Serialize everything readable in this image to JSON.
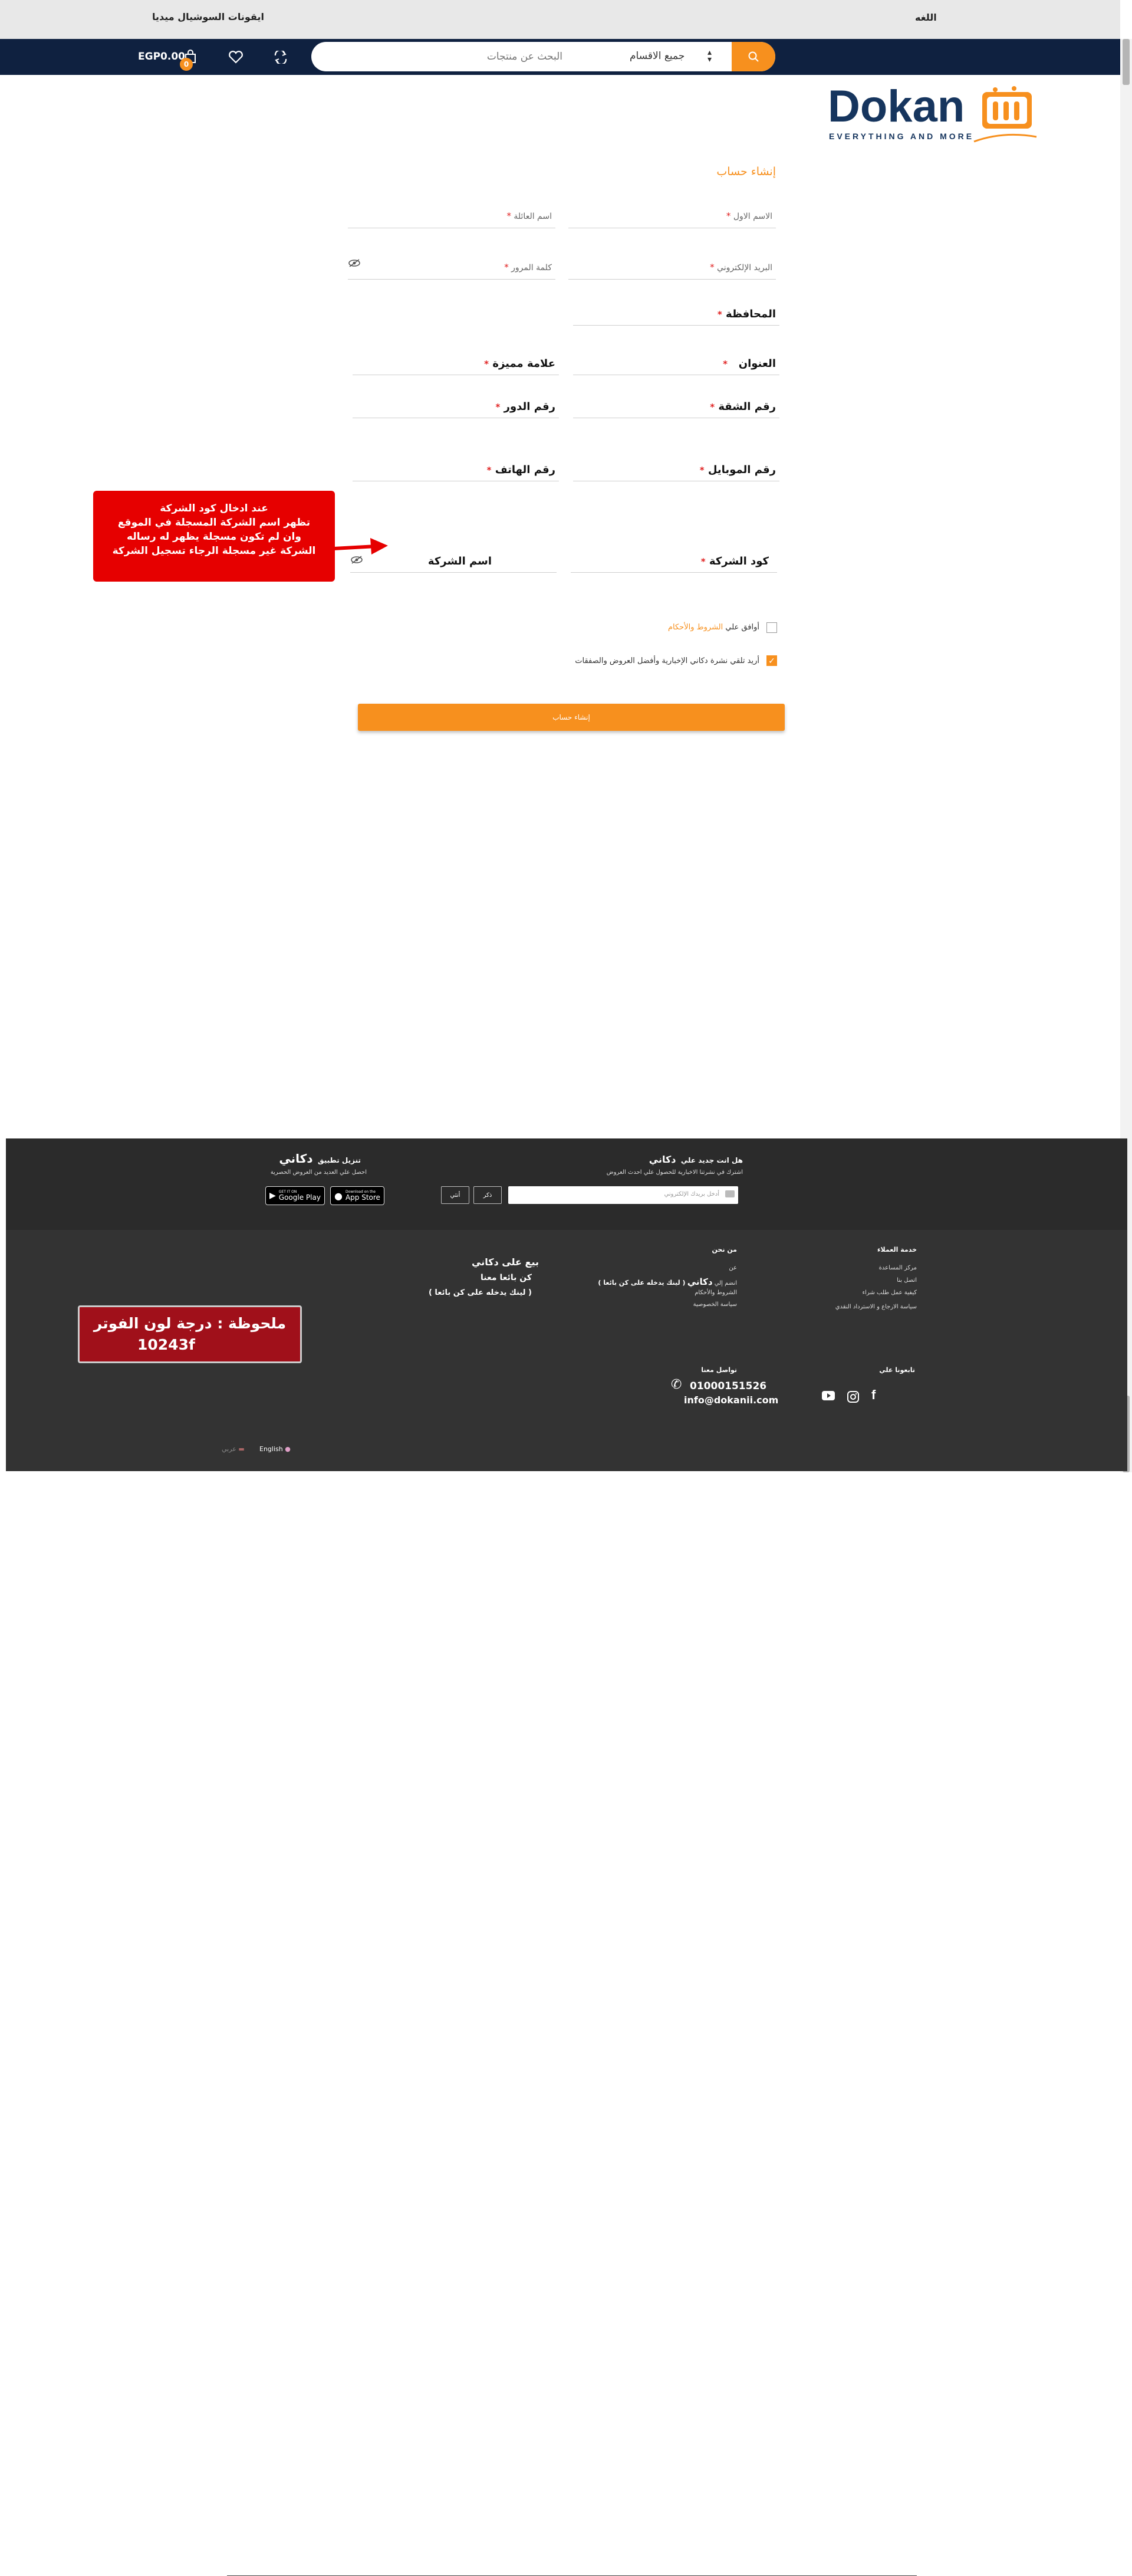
{
  "topbar": {
    "language_label": "اللغه",
    "social_label": "ايقونات السوشيال ميديا"
  },
  "navbar": {
    "search_placeholder": "البحث عن منتجات",
    "category_select": "جميع الاقسام",
    "cart_total": "EGP0.00",
    "cart_count": "0"
  },
  "logo": {
    "brand": "Dokan",
    "tagline": "EVERYTHING AND MORE"
  },
  "form": {
    "title": "إنشاء حساب",
    "fields": {
      "first_name": "الاسم الاول",
      "last_name": "اسم العائلة",
      "email": "البريد الإلكتروني",
      "password": "كلمة المرور",
      "governorate": "المحافظة",
      "address": "العنوان",
      "landmark": "علامة مميزة",
      "apartment": "رقم الشقة",
      "floor": "رقم الدور",
      "mobile": "رقم الموبايل",
      "phone": "رقم الهاتف",
      "company_code": "كود الشركة",
      "company_name": "اسم الشركة"
    },
    "required_mark": "*",
    "terms_prefix": "أوافق علي",
    "terms_link": "الشروط والأحكام",
    "newsletter_label": "أريد تلقي نشرة دكاني الإخبارية وأفضل العروض والصفقات",
    "submit_label": "إنشاء حساب"
  },
  "callout": {
    "lines": [
      "عند ادخال كود الشركة",
      "تظهر اسم الشركة المسجلة في الموقع",
      "وان لم تكون مسجلة يظهر له رساله",
      "الشركة غير مسجلة الرجاء تسجيل الشركة"
    ]
  },
  "footer": {
    "newsletter_title": "هل انت جديد علي",
    "brand_ar": "دكاني",
    "newsletter_sub": "اشترك في نشرتنا الاخبارية للحصول علي احدث العروض",
    "email_placeholder": "أدخل بريدك الإلكتروني",
    "male_btn": "ذكر",
    "female_btn": "أنثي",
    "app_title": "تنزيل تطبيق",
    "app_sub": "احصل علي العديد من العروض الحصرية",
    "google_play_top": "GET IT ON",
    "google_play": "Google Play",
    "app_store_top": "Download on the",
    "app_store": "App Store",
    "customer_service_title": "خدمة العملاء",
    "customer_service_links": [
      "مركز المساعدة",
      "اتصل بنا",
      "كيفية عمل طلب شراء",
      "سياسة الارجاع و الاسترداد النقدي"
    ],
    "about_title": "من نحن",
    "about_links": [
      "عن",
      "انضم إلي",
      "الشروط والأحكام",
      "سياسة الخصوصية"
    ],
    "about_brand": "دكاني",
    "join_link_note": "( لينك يدخله على كن بائعا )",
    "sell_title": "بيع على دكاني",
    "sell_sub": "كن بائعا معنا",
    "sell_note": "( لينك يدخله على كن بائعا )",
    "follow_title": "تابعونا علي",
    "contact_title": "تواصل معنا",
    "phone": "01000151526",
    "email": "info@dokanii.com",
    "lang_en": "English",
    "lang_ar": "عربي",
    "note_line1": "ملحوظة : درجة لون الفوتر",
    "note_line2": "10243f"
  },
  "colors": {
    "accent": "#f7901e",
    "navbar": "#0f2140",
    "footer": "#333333",
    "callout": "#e60000"
  }
}
